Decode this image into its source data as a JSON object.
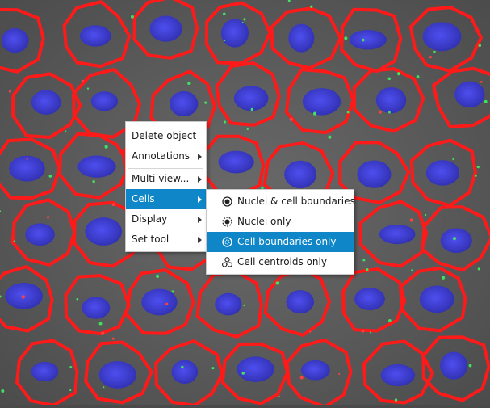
{
  "viewer": {
    "image_name": "fluorescence-cell-segmentation-image",
    "colors": {
      "boundary": "#ff1010",
      "nucleus": "#3a3ad8",
      "background": "#5a5a5a"
    }
  },
  "context_menu": {
    "items": [
      {
        "label": "Delete object",
        "has_submenu": false
      },
      {
        "label": "Annotations",
        "has_submenu": true
      },
      {
        "label": "Multi-view...",
        "has_submenu": true
      },
      {
        "label": "Cells",
        "has_submenu": true,
        "active": true
      },
      {
        "label": "Display",
        "has_submenu": true
      },
      {
        "label": "Set tool",
        "has_submenu": true
      }
    ]
  },
  "cells_submenu": {
    "items": [
      {
        "label": "Nuclei & cell boundaries",
        "icon": "nuclei-and-boundaries-icon"
      },
      {
        "label": "Nuclei only",
        "icon": "nuclei-only-icon"
      },
      {
        "label": "Cell boundaries only",
        "icon": "cell-boundaries-icon",
        "active": true
      },
      {
        "label": "Cell centroids only",
        "icon": "cell-centroids-icon"
      }
    ]
  },
  "colors": {
    "accent": "#0e86c8",
    "menu_bg": "#ffffff",
    "menu_text": "#1a1a1a"
  }
}
